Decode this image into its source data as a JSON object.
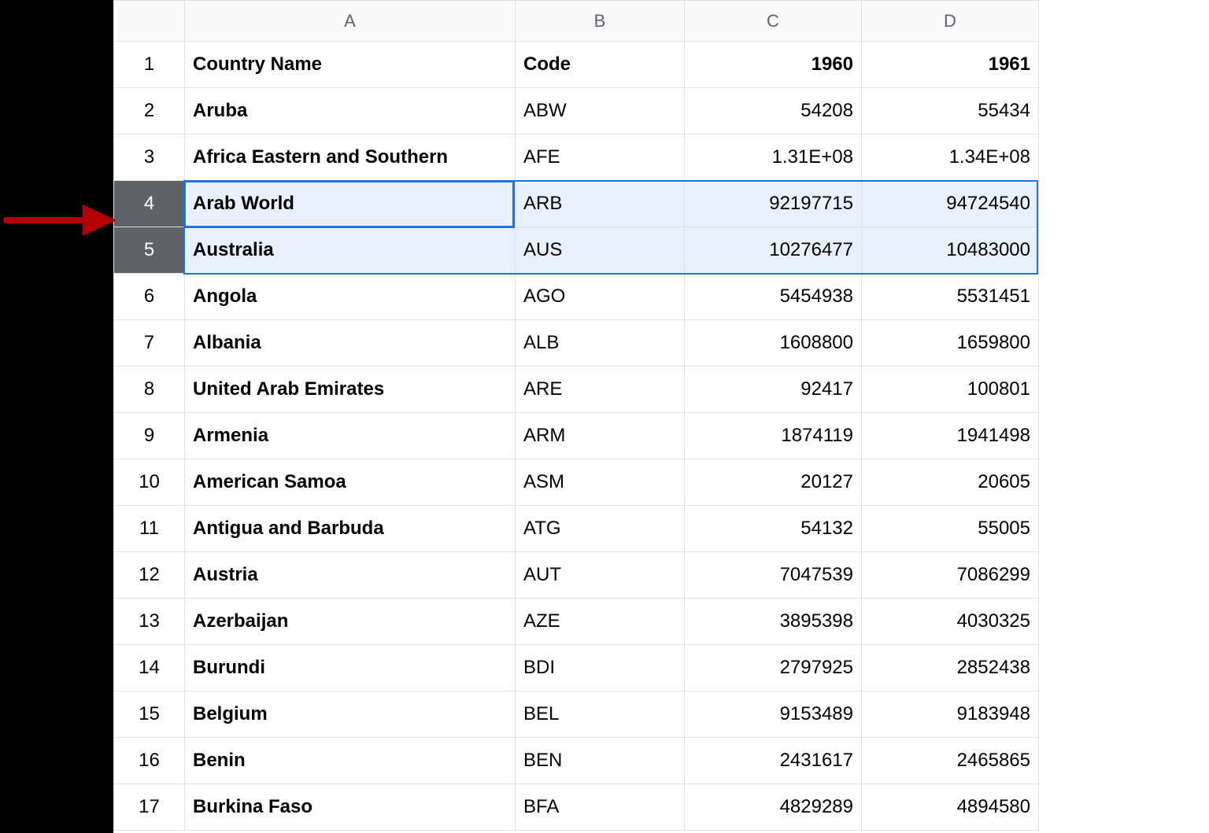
{
  "columns": {
    "A": "A",
    "B": "B",
    "C": "C",
    "D": "D"
  },
  "header": {
    "countryName": "Country Name",
    "code": "Code",
    "y1960": "1960",
    "y1961": "1961"
  },
  "selection": {
    "activeRow": 4,
    "selectedRows": [
      4,
      5
    ],
    "activeCell": "A4"
  },
  "rows": [
    {
      "n": "1"
    },
    {
      "n": "2",
      "name": "Aruba",
      "code": "ABW",
      "v1960": "54208",
      "v1961": "55434"
    },
    {
      "n": "3",
      "name": "Africa Eastern and Southern",
      "code": "AFE",
      "v1960": "1.31E+08",
      "v1961": "1.34E+08"
    },
    {
      "n": "4",
      "name": "Arab World",
      "code": "ARB",
      "v1960": "92197715",
      "v1961": "94724540"
    },
    {
      "n": "5",
      "name": "Australia",
      "code": "AUS",
      "v1960": "10276477",
      "v1961": "10483000"
    },
    {
      "n": "6",
      "name": "Angola",
      "code": "AGO",
      "v1960": "5454938",
      "v1961": "5531451"
    },
    {
      "n": "7",
      "name": "Albania",
      "code": "ALB",
      "v1960": "1608800",
      "v1961": "1659800"
    },
    {
      "n": "8",
      "name": "United Arab Emirates",
      "code": "ARE",
      "v1960": "92417",
      "v1961": "100801"
    },
    {
      "n": "9",
      "name": "Armenia",
      "code": "ARM",
      "v1960": "1874119",
      "v1961": "1941498"
    },
    {
      "n": "10",
      "name": "American Samoa",
      "code": "ASM",
      "v1960": "20127",
      "v1961": "20605"
    },
    {
      "n": "11",
      "name": "Antigua and Barbuda",
      "code": "ATG",
      "v1960": "54132",
      "v1961": "55005"
    },
    {
      "n": "12",
      "name": "Austria",
      "code": "AUT",
      "v1960": "7047539",
      "v1961": "7086299"
    },
    {
      "n": "13",
      "name": "Azerbaijan",
      "code": "AZE",
      "v1960": "3895398",
      "v1961": "4030325"
    },
    {
      "n": "14",
      "name": "Burundi",
      "code": "BDI",
      "v1960": "2797925",
      "v1961": "2852438"
    },
    {
      "n": "15",
      "name": "Belgium",
      "code": "BEL",
      "v1960": "9153489",
      "v1961": "9183948"
    },
    {
      "n": "16",
      "name": "Benin",
      "code": "BEN",
      "v1960": "2431617",
      "v1961": "2465865"
    },
    {
      "n": "17",
      "name": "Burkina Faso",
      "code": "BFA",
      "v1960": "4829289",
      "v1961": "4894580"
    }
  ],
  "annotation": {
    "arrow": "arrow-pointing-to-row-4"
  }
}
